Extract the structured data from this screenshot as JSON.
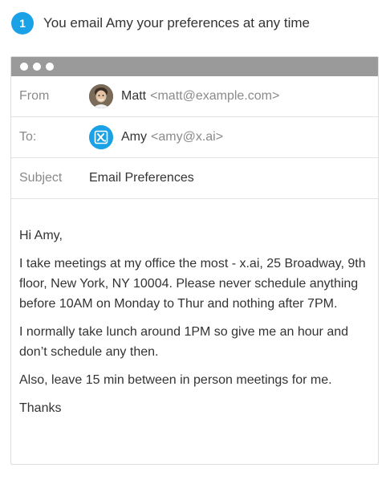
{
  "step": {
    "number": "1",
    "text": "You email Amy your preferences at any time"
  },
  "email": {
    "from": {
      "label": "From",
      "name": "Matt",
      "address": "<matt@example.com>"
    },
    "to": {
      "label": "To:",
      "name": "Amy",
      "address": "<amy@x.ai>"
    },
    "subject": {
      "label": "Subject",
      "value": "Email Preferences"
    },
    "body": {
      "greeting": "Hi Amy,",
      "p1": "I take meetings at my office the most - x.ai, 25 Broadway, 9th floor, New York, NY 10004. Please never schedule anything before 10AM on Monday to Thur and nothing after 7PM.",
      "p2": "I normally take lunch around 1PM so give me an hour and don’t schedule any then.",
      "p3": "Also, leave 15 min between in person meetings for me.",
      "signoff": "Thanks"
    }
  },
  "colors": {
    "accent": "#1aa1e6",
    "titlebar": "#9a9a9a",
    "label": "#8a8a8a"
  },
  "icons": {
    "amy_avatar": "x-ai-logo-icon",
    "matt_avatar": "user-photo-avatar"
  }
}
